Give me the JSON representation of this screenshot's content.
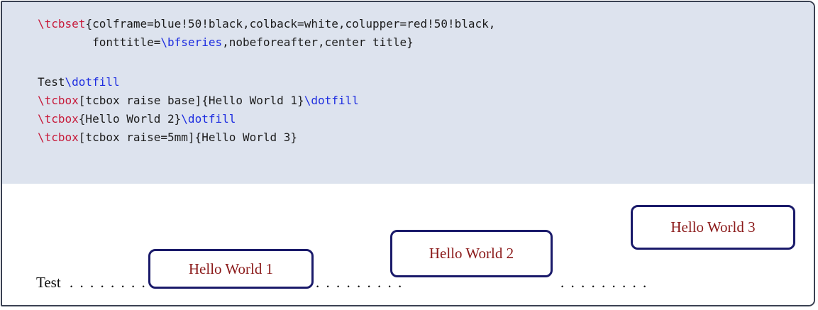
{
  "code": {
    "line1": {
      "kw": "\\tcbset",
      "rest": "{colframe=blue!50!black,colback=white,colupper=red!50!black,"
    },
    "line2": {
      "pre": "        fonttitle=",
      "cmd": "\\bfseries",
      "rest": ",nobeforeafter,center title}"
    },
    "line3": {
      "text": "Test",
      "cmd": "\\dotfill"
    },
    "line4": {
      "kw": "\\tcbox",
      "rest": "[tcbox raise base]{Hello World 1}",
      "cmd": "\\dotfill"
    },
    "line5": {
      "kw": "\\tcbox",
      "rest": "{Hello World 2}",
      "cmd": "\\dotfill"
    },
    "line6": {
      "kw": "\\tcbox",
      "rest": "[tcbox raise=5mm]{Hello World 3}"
    }
  },
  "output": {
    "test_label": "Test",
    "dots": ". . . . . . . . .",
    "box1": "Hello World 1",
    "box2": "Hello World 2",
    "box3": "Hello World 3"
  },
  "colors": {
    "frame": "#3a4152",
    "upper_bg": "#dde3ee",
    "keyword": "#c71a3a",
    "command": "#1d2de0",
    "box_frame": "#1a1a6a",
    "box_text": "#8b1a1a"
  }
}
